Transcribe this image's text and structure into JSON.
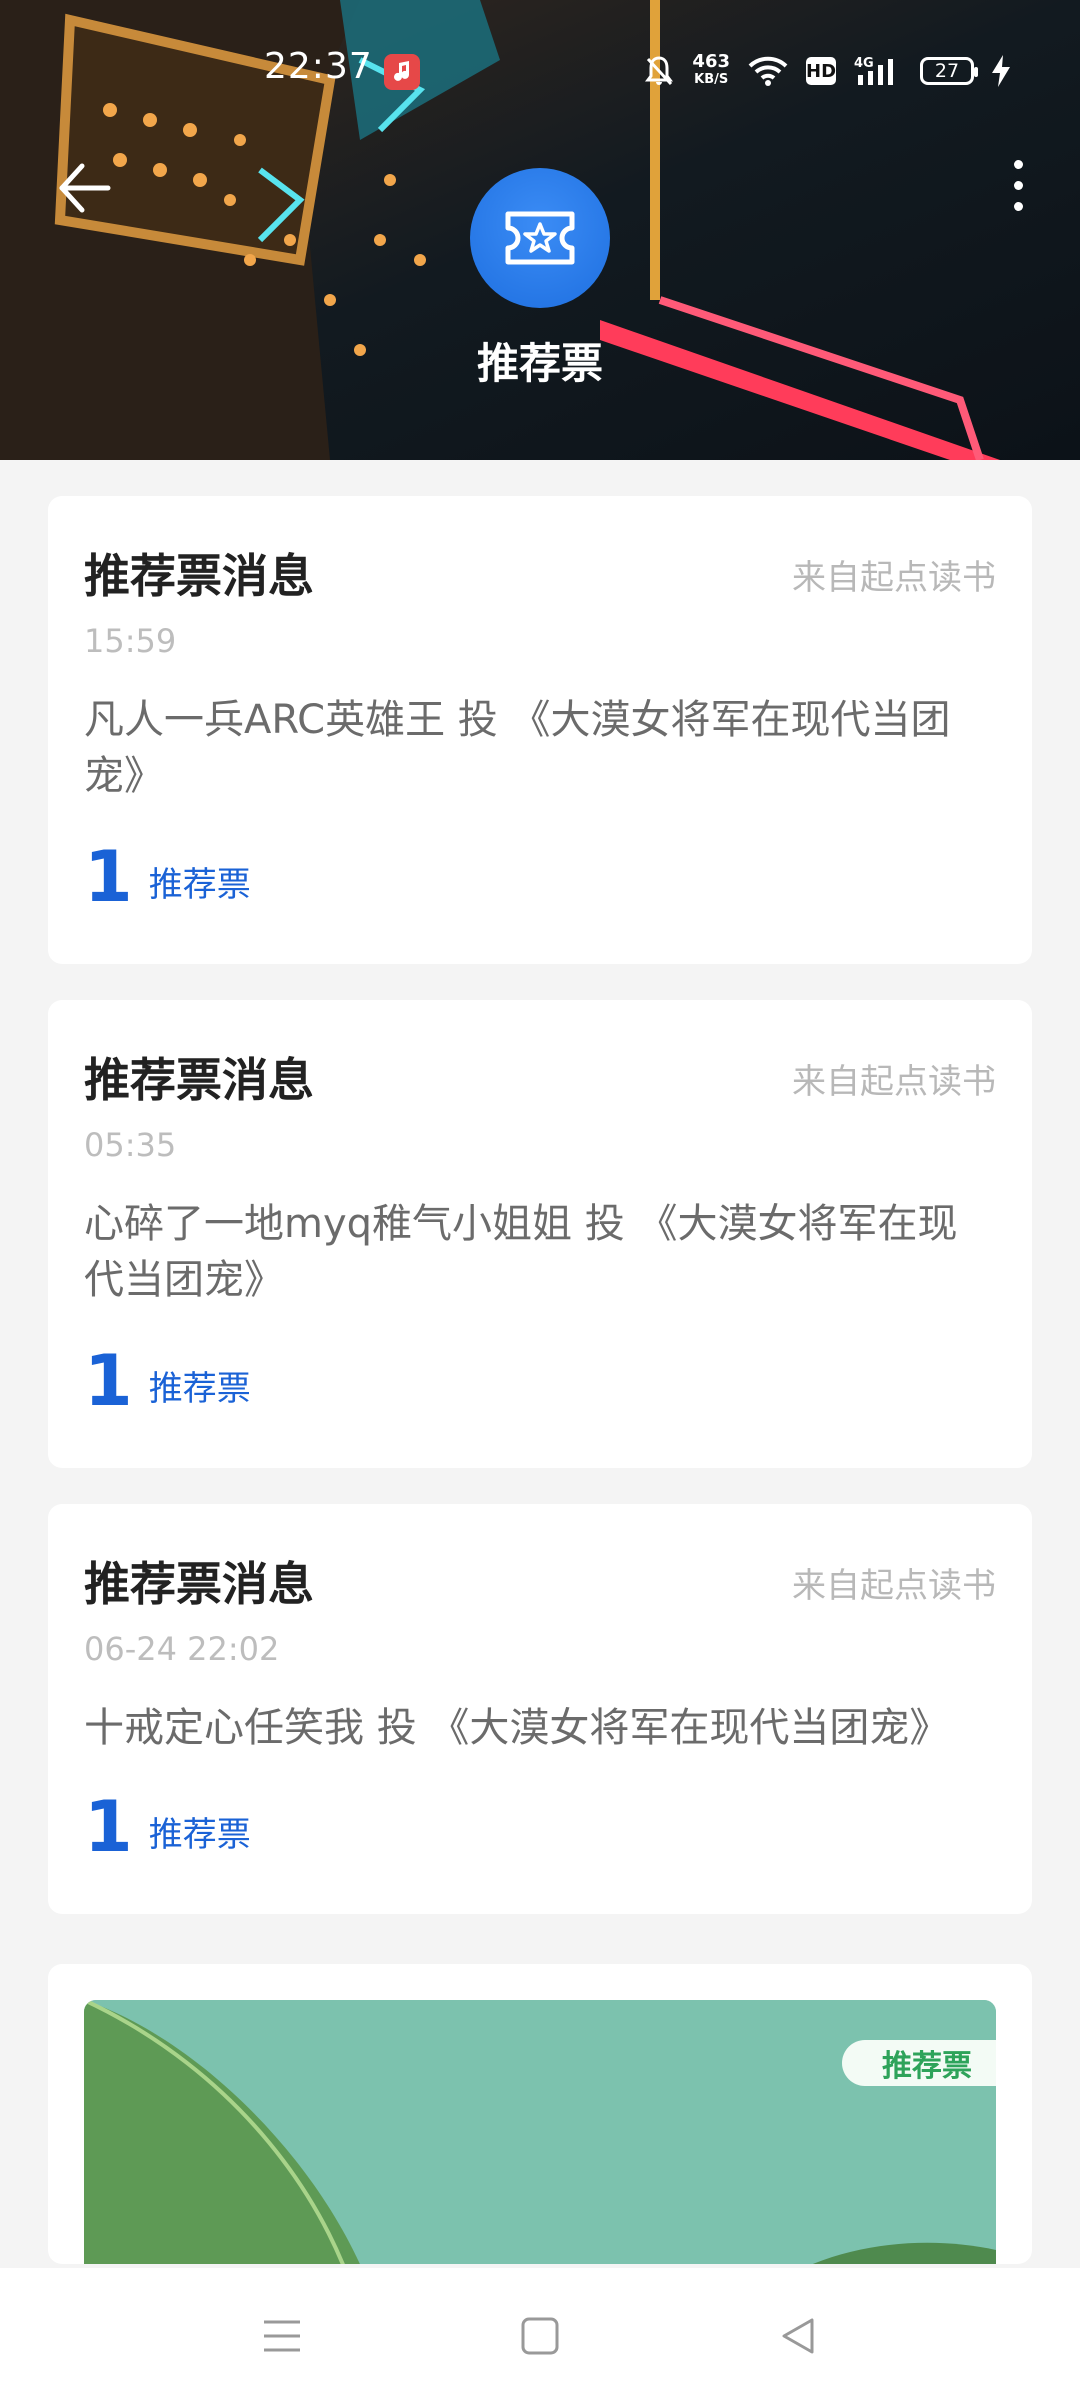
{
  "status_bar": {
    "time": "22:37",
    "net_speed_value": "463",
    "net_speed_unit": "KB/S",
    "hd": "HD",
    "signal": "4G",
    "battery": "27"
  },
  "header": {
    "title": "推荐票",
    "icon": "ticket-star-icon"
  },
  "messages": [
    {
      "title": "推荐票消息",
      "source": "来自起点读书",
      "time": "15:59",
      "body": "凡人一兵ARC英雄王 投 《大漠女将军在现代当团宠》",
      "count": "1",
      "count_label": "推荐票"
    },
    {
      "title": "推荐票消息",
      "source": "来自起点读书",
      "time": "05:35",
      "body": "心碎了一地myq稚气小姐姐 投 《大漠女将军在现代当团宠》",
      "count": "1",
      "count_label": "推荐票"
    },
    {
      "title": "推荐票消息",
      "source": "来自起点读书",
      "time": "06-24 22:02",
      "body": "十戒定心任笑我 投 《大漠女将军在现代当团宠》",
      "count": "1",
      "count_label": "推荐票"
    }
  ],
  "banner": {
    "tag": "推荐票"
  },
  "colors": {
    "accent": "#1a62d6",
    "tag_green": "#2ea35a"
  }
}
